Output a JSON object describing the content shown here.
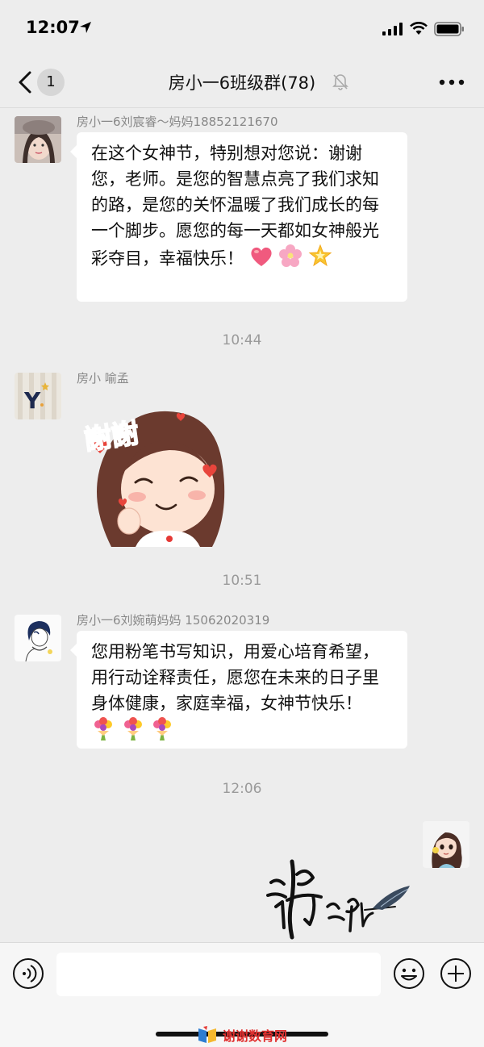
{
  "status_bar": {
    "time": "12:07"
  },
  "nav": {
    "back_badge": "1",
    "title": "房小一6班级群(78)"
  },
  "messages": [
    {
      "sender": "房小一6刘宸睿～妈妈18852121670",
      "text": "在这个女神节，特别想对您说：谢谢您，老师。是您的智慧点亮了我们求知的路，是您的关怀温暖了我们成长的每一个脚步。愿您的每一天都如女神般光彩夺目，幸福快乐！",
      "emojis": [
        "heart",
        "cherry-blossom",
        "glowing-star"
      ]
    },
    {
      "timestamp": "10:44",
      "sender": "房小 喻孟",
      "sticker_text": "謝謝"
    },
    {
      "timestamp": "10:51",
      "sender": "房小一6刘婉萌妈妈 15062020319",
      "text": "您用粉笔书写知识，用爱心培育希望，用行动诠释责任，愿您在未来的日子里身体健康，家庭幸福，女神节快乐！",
      "emojis": [
        "bouquet",
        "bouquet",
        "bouquet"
      ]
    },
    {
      "timestamp": "12:06",
      "sender": "self",
      "signature": "handwritten-signature"
    }
  ],
  "input": {
    "placeholder": ""
  },
  "watermark": {
    "text": "谢谢数育网"
  },
  "colors": {
    "background": "#ededed",
    "bubble": "#ffffff",
    "timestamp": "#9a9a9a",
    "watermark": "#e0302f"
  }
}
